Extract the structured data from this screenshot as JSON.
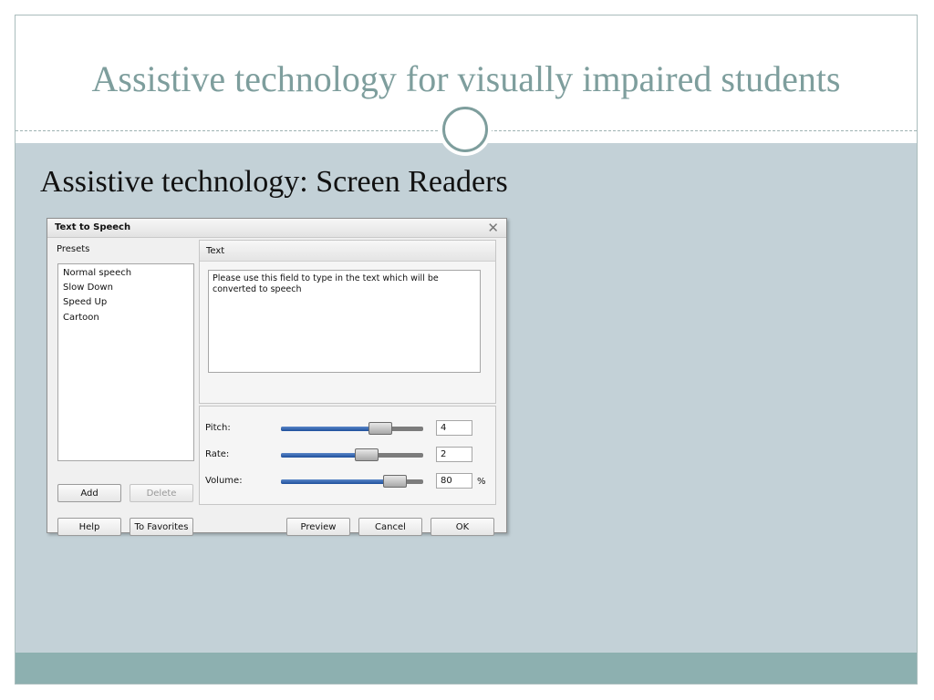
{
  "slide": {
    "title": "Assistive technology for visually impaired students",
    "subtitle": "Assistive technology: Screen Readers"
  },
  "dialog": {
    "title": "Text to Speech",
    "close_icon": "close-icon",
    "presets_label": "Presets",
    "presets": [
      "Normal speech",
      "Slow Down",
      "Speed Up",
      "Cartoon"
    ],
    "add_label": "Add",
    "delete_label": "Delete",
    "text_header": "Text",
    "text_value": "Please use this field to type in the text which will be converted to speech",
    "pitch": {
      "label": "Pitch:",
      "value": "4",
      "level": 0.7
    },
    "rate": {
      "label": "Rate:",
      "value": "2",
      "level": 0.6
    },
    "volume": {
      "label": "Volume:",
      "value": "80",
      "unit": "%",
      "level": 0.8
    },
    "buttons": {
      "help": "Help",
      "favorites": "To Favorites",
      "preview": "Preview",
      "cancel": "Cancel",
      "ok": "OK"
    }
  },
  "colors": {
    "title": "#7e9e9d",
    "content_bg": "#c3d1d7",
    "footer_bg": "#8db0b0",
    "slider_fill": "#2a5ba8"
  }
}
